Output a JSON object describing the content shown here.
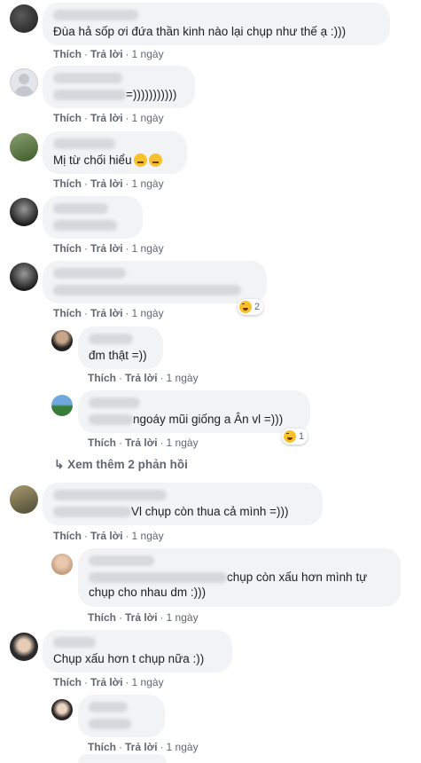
{
  "actions": {
    "like": "Thích",
    "reply": "Trả lời",
    "time": "1 ngày"
  },
  "comments": [
    {
      "text": "Đùa hả sốp ơi đứa thần kinh nào lại chụp như thế ạ :)))"
    },
    {
      "text": "=)))))))))))"
    },
    {
      "text": "Mị từ chối hiểu"
    },
    {
      "text": ""
    },
    {
      "text": "",
      "reaction_count": "2"
    },
    {
      "text": "đm thật =))"
    },
    {
      "text": "ngoáy mũi giống a Ân vl =)))",
      "reaction_count": "1"
    },
    {
      "text": "Vl chụp còn thua cả mình =)))"
    },
    {
      "text_line1": "chụp còn xấu hơn mình tự",
      "text_line2": "chụp cho nhau dm :)))"
    },
    {
      "text": "Chụp xấu hơn t chụp nữa :))"
    },
    {
      "text": ""
    }
  ],
  "more_replies": "Xem thêm 2 phản hồi",
  "colors": {
    "bubble": "#f2f3f5",
    "meta": "#606770",
    "text": "#1c1e21"
  }
}
